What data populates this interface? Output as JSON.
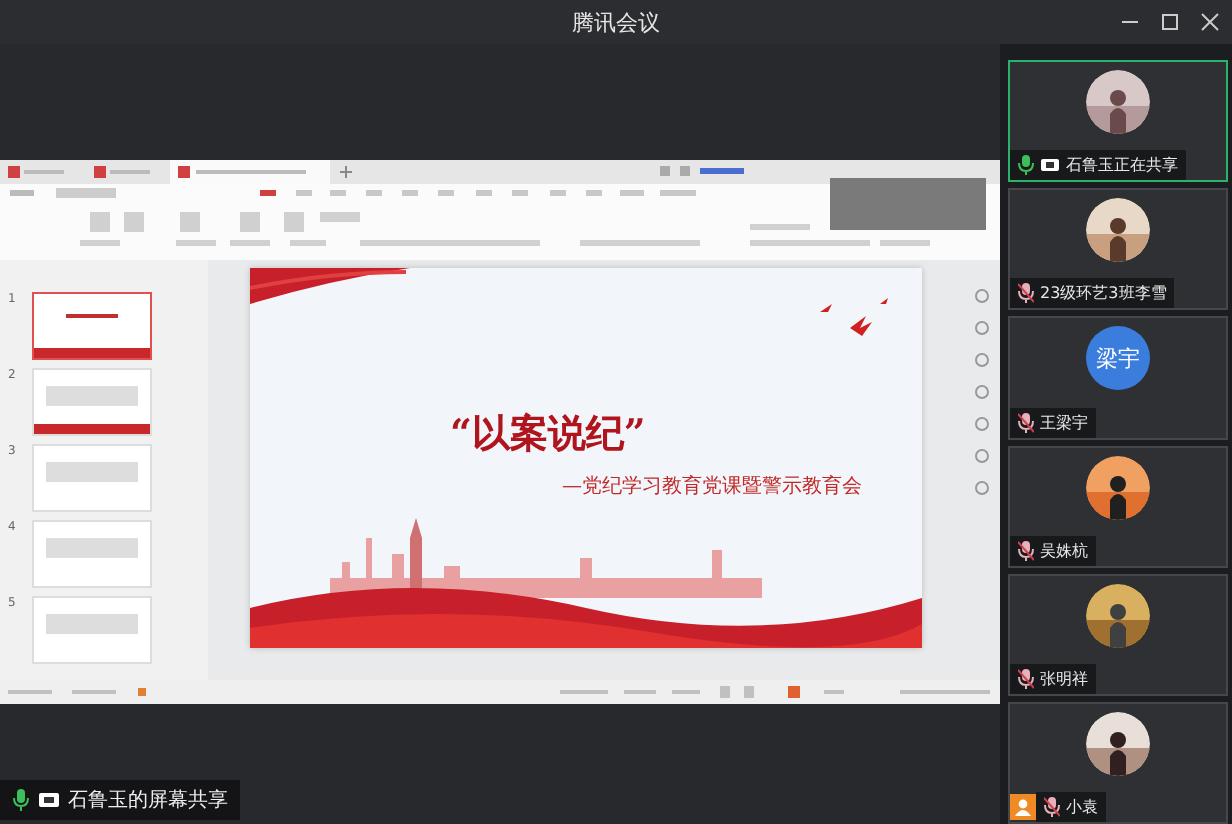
{
  "window": {
    "title": "腾讯会议"
  },
  "shared_screen": {
    "slide": {
      "title": "“以案说纪”",
      "subtitle": "—党纪学习教育党课暨警示教育会"
    },
    "thumbnails": [
      {
        "number": "1",
        "selected": true
      },
      {
        "number": "2",
        "selected": false
      },
      {
        "number": "3",
        "selected": false
      },
      {
        "number": "4",
        "selected": false
      },
      {
        "number": "5",
        "selected": false
      }
    ],
    "caption": {
      "text": "石鲁玉的屏幕共享",
      "muted": false
    }
  },
  "participants": [
    {
      "name": "石鲁玉正在共享",
      "muted": false,
      "sharing": true,
      "selected": true,
      "badge": false
    },
    {
      "name": "23级环艺3班李雪",
      "muted": true,
      "sharing": false,
      "selected": false,
      "badge": false
    },
    {
      "name": "王梁宇",
      "muted": true,
      "sharing": false,
      "selected": false,
      "avatar": {
        "kind": "initials",
        "text": "梁宇"
      },
      "badge": false
    },
    {
      "name": "吴姝杭",
      "muted": true,
      "sharing": false,
      "selected": false,
      "badge": false
    },
    {
      "name": "张明祥",
      "muted": true,
      "sharing": false,
      "selected": false,
      "badge": false
    },
    {
      "name": "小袁",
      "muted": true,
      "sharing": false,
      "selected": false,
      "badge": true
    }
  ]
}
